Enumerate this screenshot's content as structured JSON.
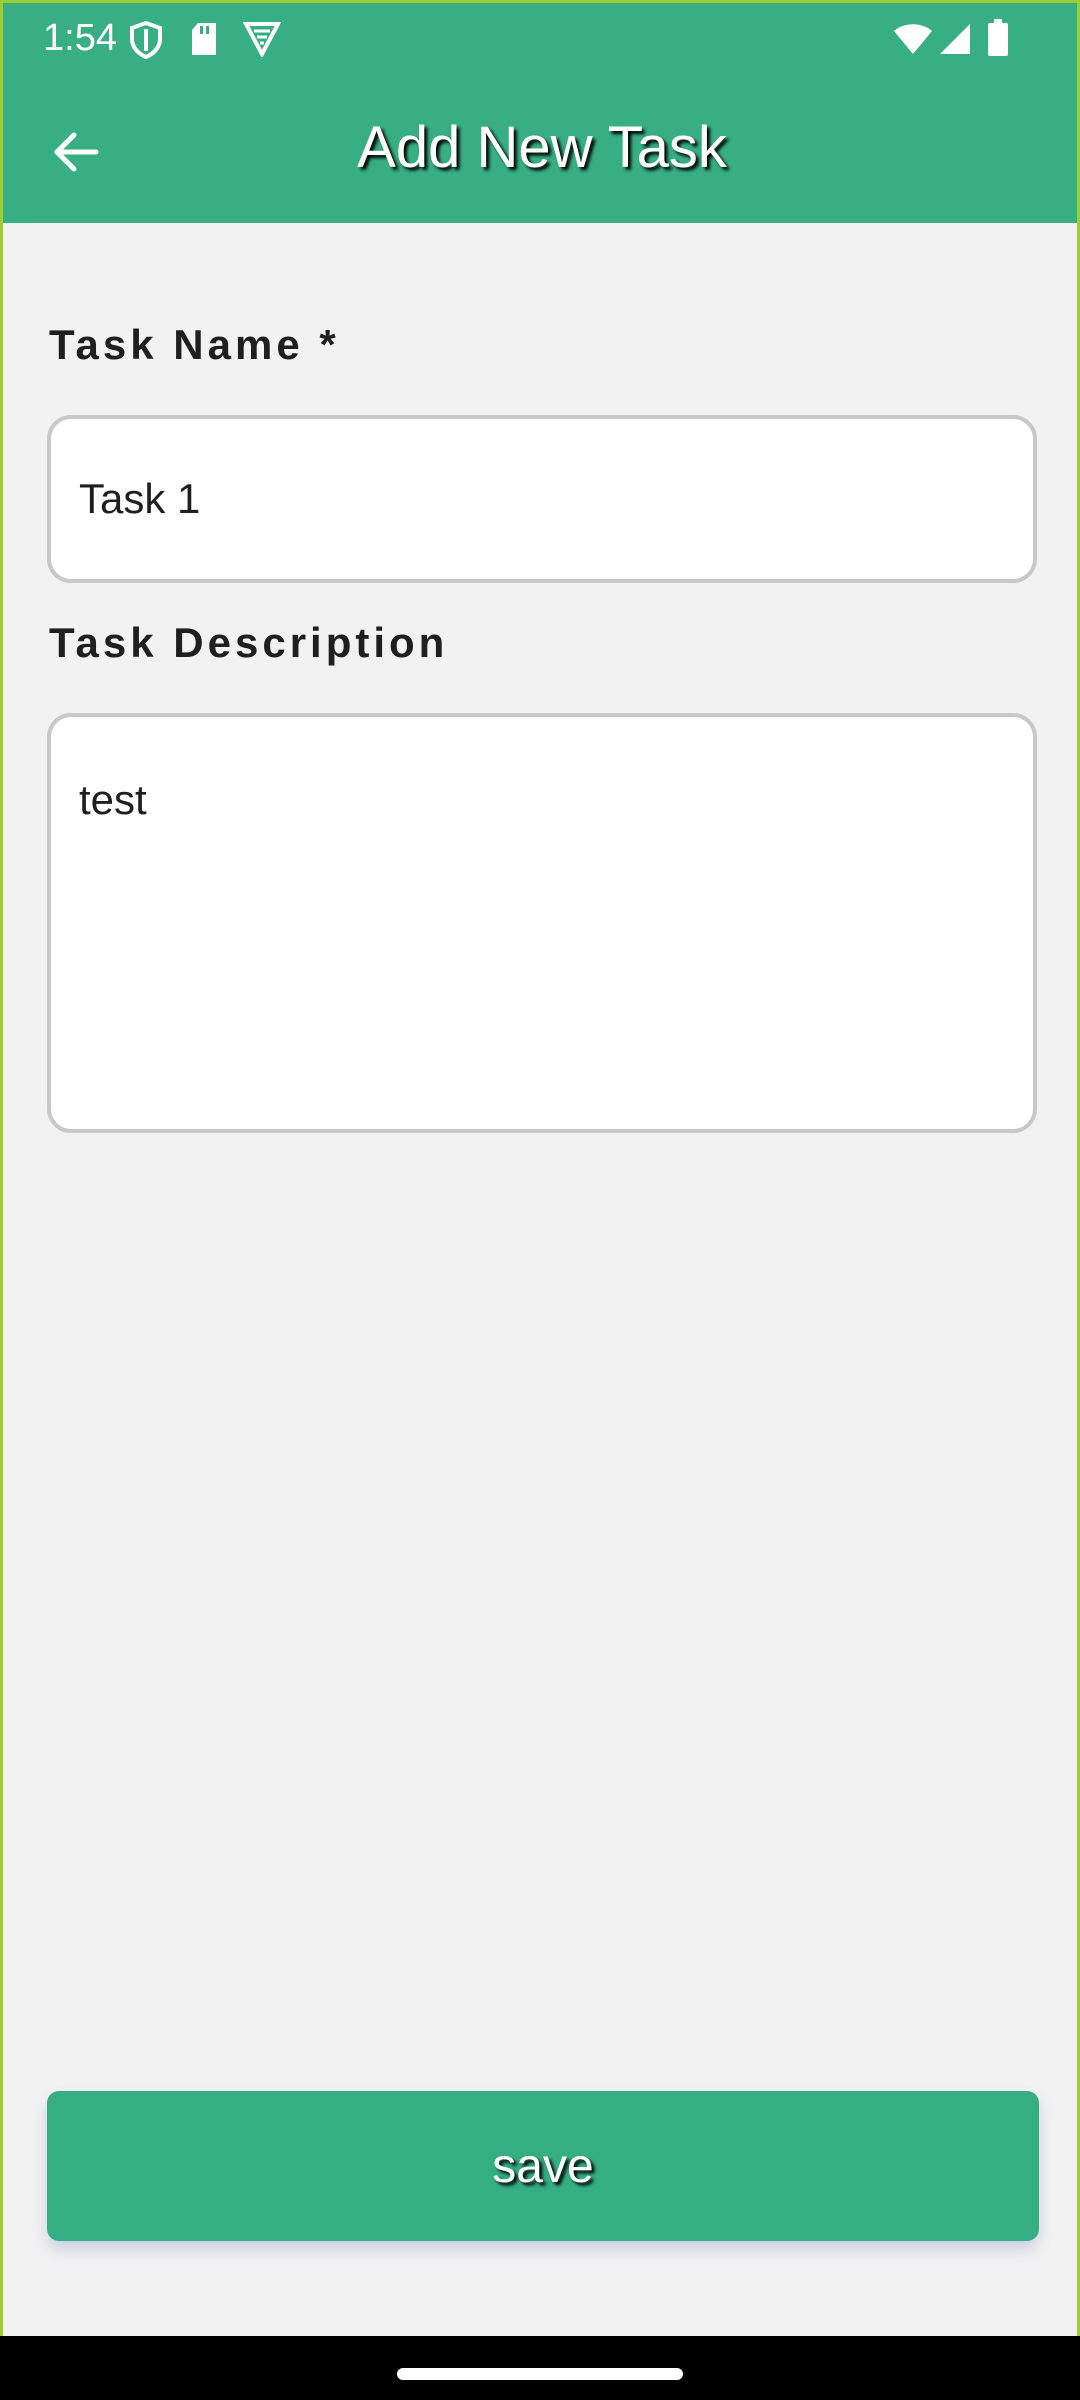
{
  "status_bar": {
    "time": "1:54",
    "icons_left": [
      "shield-icon",
      "sd-card-icon",
      "vpn-icon"
    ],
    "icons_right": [
      "wifi-icon",
      "signal-icon",
      "battery-icon"
    ]
  },
  "app_bar": {
    "title": "Add New Task",
    "back_icon": "arrow-back-icon"
  },
  "form": {
    "task_name_label": "Task Name *",
    "task_name_value": "Task 1",
    "task_description_label": "Task Description",
    "task_description_value": "test"
  },
  "actions": {
    "save_label": "save"
  },
  "colors": {
    "primary": "#38ae84",
    "background": "#f2f2f3",
    "input_border": "#c8c8c8",
    "frame_border": "#9ccc2f"
  }
}
